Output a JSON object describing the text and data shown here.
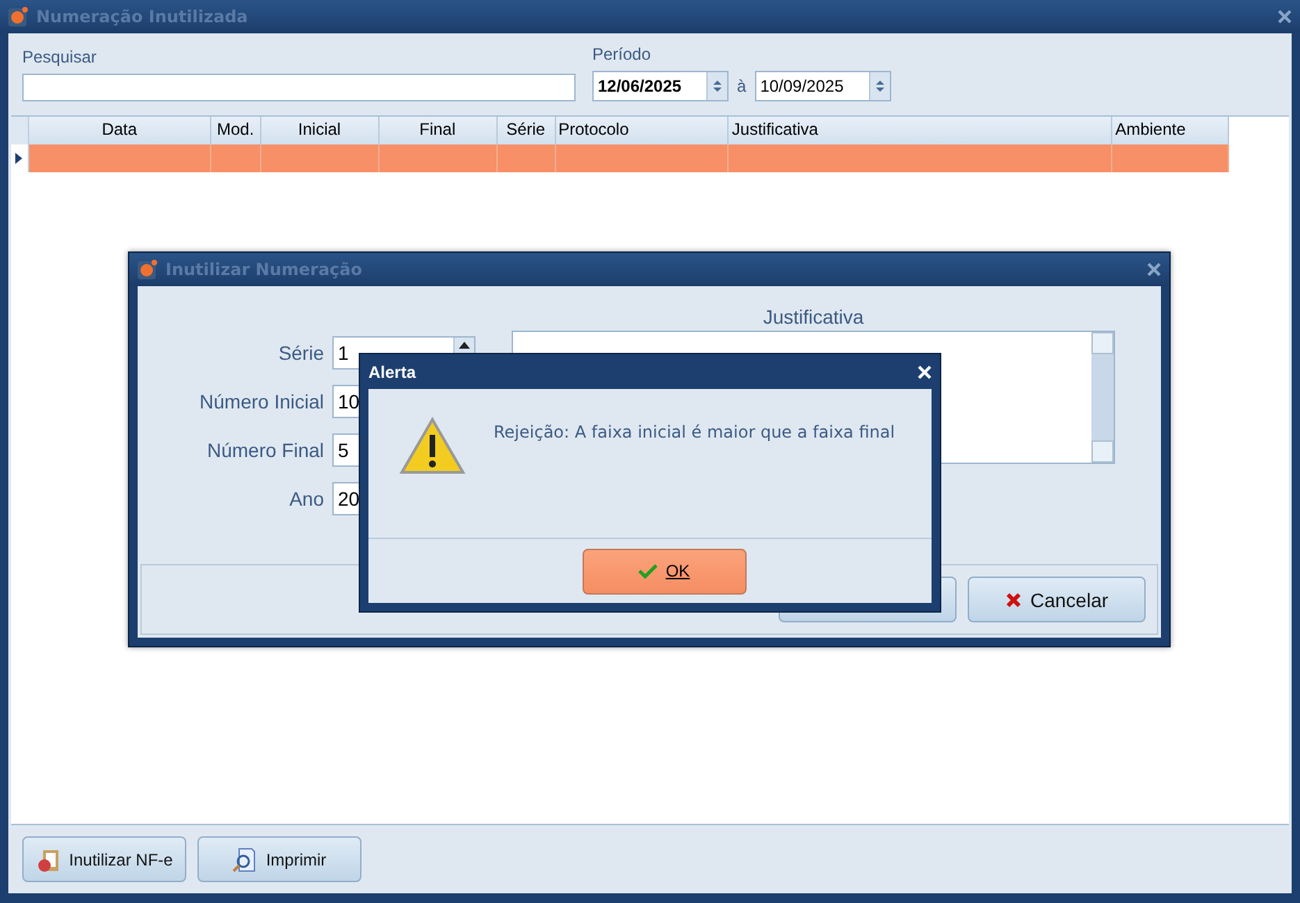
{
  "window": {
    "title": "Numeração Inutilizada"
  },
  "filters": {
    "search_label": "Pesquisar",
    "period_label": "Período",
    "date_from": "12/06/2025",
    "date_sep": "à",
    "date_to": "10/09/2025"
  },
  "table": {
    "columns": [
      {
        "label": "Data"
      },
      {
        "label": "Mod."
      },
      {
        "label": "Inicial"
      },
      {
        "label": "Final"
      },
      {
        "label": "Série"
      },
      {
        "label": "Protocolo"
      },
      {
        "label": "Justificativa"
      },
      {
        "label": "Ambiente"
      }
    ],
    "rows": [
      {
        "selected": true,
        "cells": [
          "",
          "",
          "",
          "",
          "",
          "",
          "",
          ""
        ]
      }
    ]
  },
  "footer_buttons": [
    {
      "label": "Inutilizar NF-e",
      "kind": "clipboard"
    },
    {
      "label": "Imprimir",
      "kind": "print"
    }
  ],
  "dialog": {
    "title": "Inutilizar Numeração",
    "fields": [
      {
        "label": "Série",
        "value": "1",
        "kind": "spin"
      },
      {
        "label": "Número Inicial",
        "value": "10",
        "kind": "text"
      },
      {
        "label": "Número Final",
        "value": "5",
        "kind": "text"
      },
      {
        "label": "Ano",
        "value": "20",
        "kind": "text"
      }
    ],
    "justification_label": "Justificativa",
    "cancel_label": "Cancelar"
  },
  "alert": {
    "title": "Alerta",
    "message": "Rejeição: A faixa inicial é maior que a faixa final",
    "ok_label": "OK"
  }
}
